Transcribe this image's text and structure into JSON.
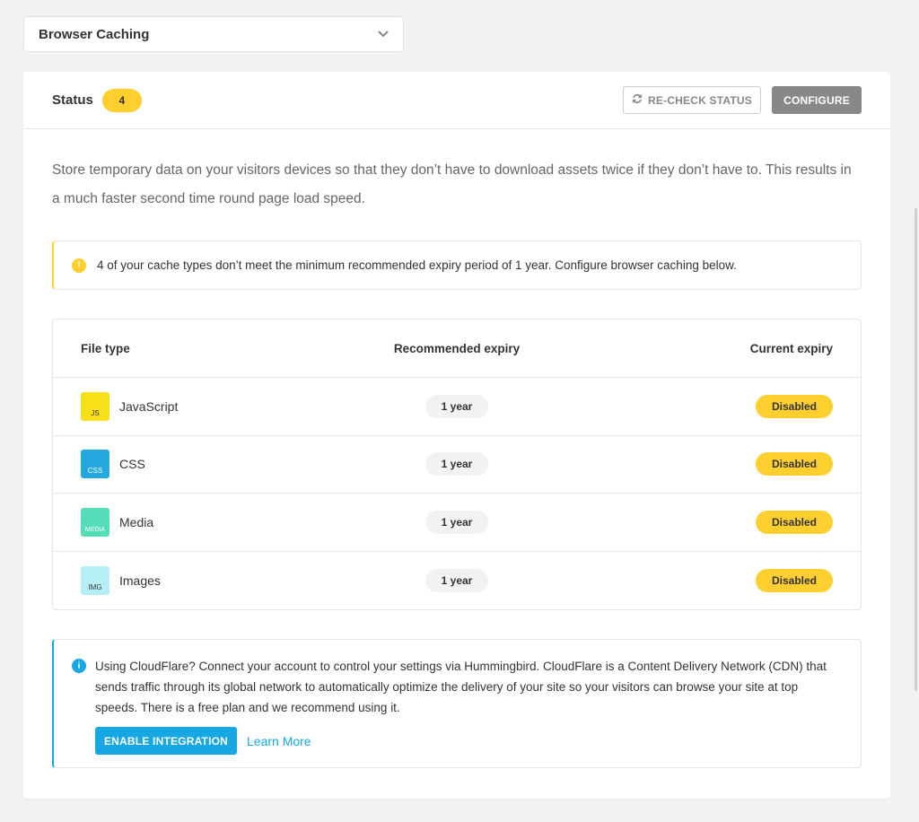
{
  "selector": {
    "label": "Browser Caching"
  },
  "header": {
    "title": "Status",
    "count": "4",
    "recheck_label": "RE-CHECK STATUS",
    "configure_label": "CONFIGURE"
  },
  "intro": "Store temporary data on your visitors devices so that they don’t have to download assets twice if they don’t have to. This results in a much faster second time round page load speed.",
  "warning": {
    "icon": "warning-icon",
    "text": "4 of your cache types don’t meet the minimum recommended expiry period of 1 year. Configure browser caching below."
  },
  "table": {
    "headers": [
      "File type",
      "Recommended expiry",
      "Current expiry"
    ],
    "rows": [
      {
        "badge": "JS",
        "name": "JavaScript",
        "recommended": "1 year",
        "current": "Disabled"
      },
      {
        "badge": "CSS",
        "name": "CSS",
        "recommended": "1 year",
        "current": "Disabled"
      },
      {
        "badge": "MEDIA",
        "name": "Media",
        "recommended": "1 year",
        "current": "Disabled"
      },
      {
        "badge": "IMG",
        "name": "Images",
        "recommended": "1 year",
        "current": "Disabled"
      }
    ]
  },
  "cloudflare": {
    "icon": "info-icon",
    "text": "Using CloudFlare? Connect your account to control your settings via Hummingbird. CloudFlare is a Content Delivery Network (CDN) that sends traffic through its global network to automatically optimize the delivery of your site so your visitors can browse your site at top speeds. There is a free plan and we recommend using it.",
    "enable_label": "ENABLE INTEGRATION",
    "learn_more_label": "Learn More"
  },
  "colors": {
    "accent_yellow": "#fecf2f",
    "accent_blue": "#17a8e3",
    "js_icon": "#f7e018",
    "css_icon": "#25a8e0",
    "media_icon": "#55ddb8",
    "img_icon": "#b6eef6"
  }
}
